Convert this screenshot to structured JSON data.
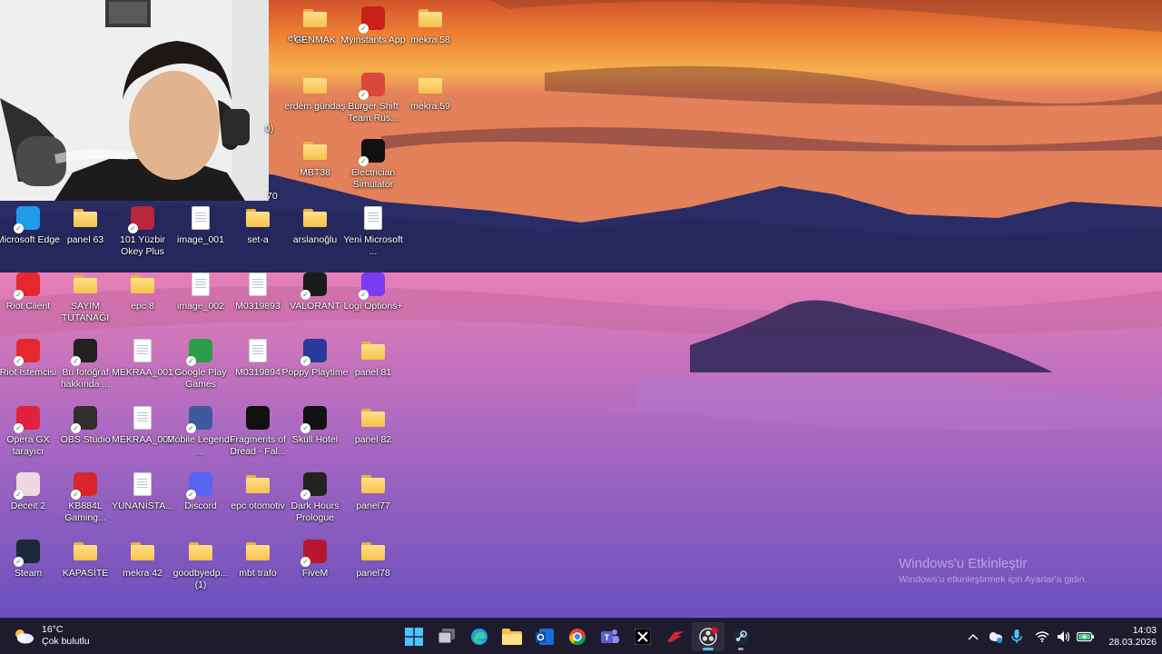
{
  "desktop": {
    "icons": [
      {
        "label": "etup",
        "type": "text-partial"
      },
      {
        "label": "GENMAK",
        "type": "folder"
      },
      {
        "label": "Myinstants App",
        "type": "app",
        "color": "#c8211b"
      },
      {
        "label": "mekra 58",
        "type": "folder"
      },
      {
        "label": "erdem gündaş",
        "type": "folder"
      },
      {
        "label": "Burger Shift Team Rus...",
        "type": "app",
        "color": "#d9483b"
      },
      {
        "label": "mekra 59",
        "type": "folder"
      },
      {
        "label": "MBT38",
        "type": "folder"
      },
      {
        "label": "Electrician Simulator",
        "type": "app",
        "color": "#111111"
      },
      {
        "label": "Microsoft Edge",
        "type": "app",
        "color": "#1f9be8"
      },
      {
        "label": "panel 63",
        "type": "folder"
      },
      {
        "label": "101 Yüzbir Okey Plus",
        "type": "app",
        "color": "#b8283a"
      },
      {
        "label": "image_001",
        "type": "file"
      },
      {
        "label": "set-a",
        "type": "folder"
      },
      {
        "label": "arslanoğlu",
        "type": "folder"
      },
      {
        "label": "Yeni Microsoft ...",
        "type": "file"
      },
      {
        "label": "Riot Client",
        "type": "app",
        "color": "#e5282d"
      },
      {
        "label": "SAYIM TUTANAĞI",
        "type": "folder"
      },
      {
        "label": "epc 8",
        "type": "folder"
      },
      {
        "label": "image_002",
        "type": "file"
      },
      {
        "label": "M0319893",
        "type": "file"
      },
      {
        "label": "VALORANT",
        "type": "app",
        "color": "#1a1a1a"
      },
      {
        "label": "Logi Options+",
        "type": "app",
        "color": "#7a3cf0"
      },
      {
        "label": "Riot İstemcisi",
        "type": "app",
        "color": "#e5282d"
      },
      {
        "label": "Bu fotoğraf hakkında ...",
        "type": "app",
        "color": "#222222"
      },
      {
        "label": "MEKRAA_001",
        "type": "file"
      },
      {
        "label": "Google Play Games",
        "type": "app",
        "color": "#2a9d4a"
      },
      {
        "label": "M0319894",
        "type": "file"
      },
      {
        "label": "Poppy Playtime",
        "type": "app",
        "color": "#2a3a9a"
      },
      {
        "label": "panel 81",
        "type": "folder"
      },
      {
        "label": "Opera GX tarayıcı",
        "type": "app",
        "color": "#e0223f"
      },
      {
        "label": "OBS Studio",
        "type": "app",
        "color": "#302e31"
      },
      {
        "label": "MEKRAA_002",
        "type": "file"
      },
      {
        "label": "Mobile Legends ...",
        "type": "app",
        "color": "#3d5a9e"
      },
      {
        "label": "Fragments of Dread - Fal...",
        "type": "app",
        "color": "#111111"
      },
      {
        "label": "Skull Hotel",
        "type": "app",
        "color": "#121212"
      },
      {
        "label": "panel 82",
        "type": "folder"
      },
      {
        "label": "Deceit 2",
        "type": "app",
        "color": "#f0d8e0"
      },
      {
        "label": "KB884L Gaming...",
        "type": "app",
        "color": "#d7262e"
      },
      {
        "label": "YUNANİSTA...",
        "type": "file"
      },
      {
        "label": "Discord",
        "type": "app",
        "color": "#5865f2"
      },
      {
        "label": "epc otomotiv",
        "type": "folder"
      },
      {
        "label": "Dark Hours Prologue",
        "type": "app",
        "color": "#222222"
      },
      {
        "label": "panel77",
        "type": "folder"
      },
      {
        "label": "Steam",
        "type": "app",
        "color": "#1b2838"
      },
      {
        "label": "KAPASİTE",
        "type": "folder"
      },
      {
        "label": "mekra 42",
        "type": "folder"
      },
      {
        "label": "goodbyedp... (1)",
        "type": "folder"
      },
      {
        "label": "mbt trafo",
        "type": "folder"
      },
      {
        "label": "FiveM",
        "type": "app",
        "color": "#b7172e"
      },
      {
        "label": "panel78",
        "type": "folder"
      },
      {
        "label": "0)",
        "type": "text-partial"
      },
      {
        "label": "70",
        "type": "text-partial"
      }
    ]
  },
  "watermark": {
    "title": "Windows'u Etkinleştir",
    "subtitle": "Windows'u etkinleştirmek için Ayarlar'a gidin."
  },
  "taskbar": {
    "weather": {
      "temp": "16°C",
      "condition": "Çok bulutlu"
    },
    "apps": [
      {
        "name": "start",
        "icon": "windows-logo-icon"
      },
      {
        "name": "task-view",
        "icon": "task-view-icon"
      },
      {
        "name": "edge",
        "icon": "edge-icon"
      },
      {
        "name": "explorer",
        "icon": "folder-icon"
      },
      {
        "name": "outlook",
        "icon": "outlook-icon"
      },
      {
        "name": "chrome",
        "icon": "chrome-icon"
      },
      {
        "name": "teams",
        "icon": "teams-icon"
      },
      {
        "name": "x",
        "icon": "x-icon"
      },
      {
        "name": "gaming",
        "icon": "gaming-icon"
      },
      {
        "name": "obs",
        "icon": "obs-icon"
      },
      {
        "name": "steam",
        "icon": "steam-icon"
      }
    ],
    "clock": {
      "time": "14:03",
      "date": "28.03.2026"
    }
  }
}
